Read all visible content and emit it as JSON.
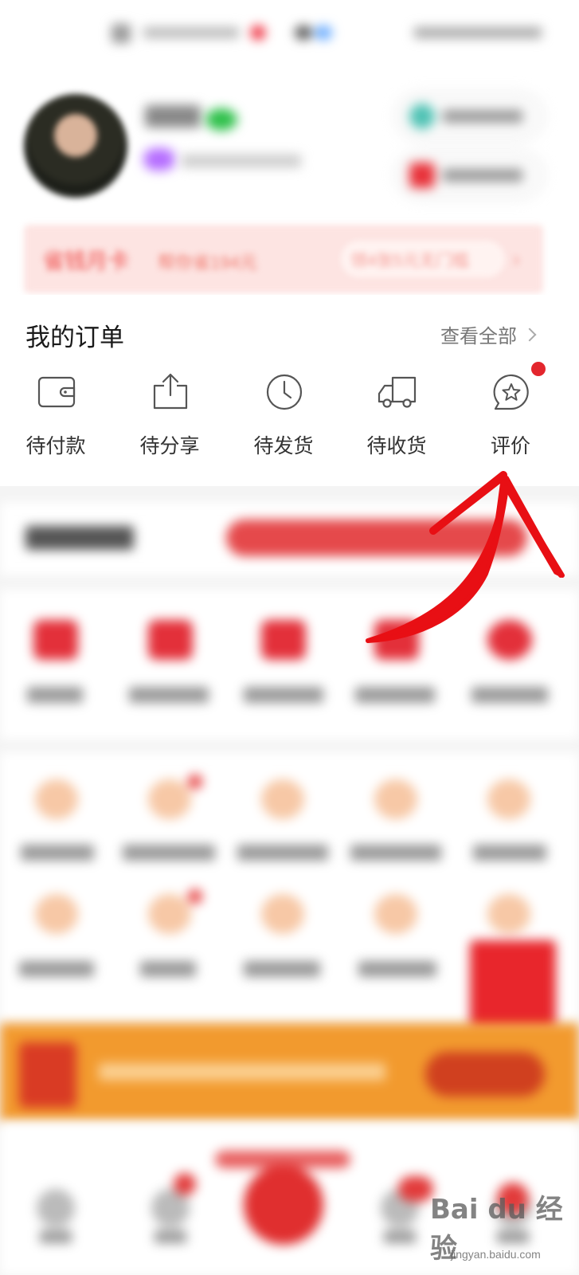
{
  "promo": {
    "title": "省钱月卡",
    "subtitle": "帮你省194元",
    "coupon": "领4张5元无门槛",
    "arrow": "›"
  },
  "orders": {
    "title": "我的订单",
    "view_all": "查看全部",
    "items": [
      {
        "label": "待付款",
        "icon": "wallet-icon"
      },
      {
        "label": "待分享",
        "icon": "share-icon"
      },
      {
        "label": "待发货",
        "icon": "clock-icon"
      },
      {
        "label": "待收货",
        "icon": "truck-icon"
      },
      {
        "label": "评价",
        "icon": "review-star-icon",
        "badge": true
      }
    ]
  },
  "colors": {
    "accent_red": "#e3262d",
    "promo_text": "#f37a78",
    "orange_banner": "#f29a2e"
  },
  "watermark": {
    "brand": "Bai du 经验",
    "url": "jingyan.baidu.com"
  }
}
